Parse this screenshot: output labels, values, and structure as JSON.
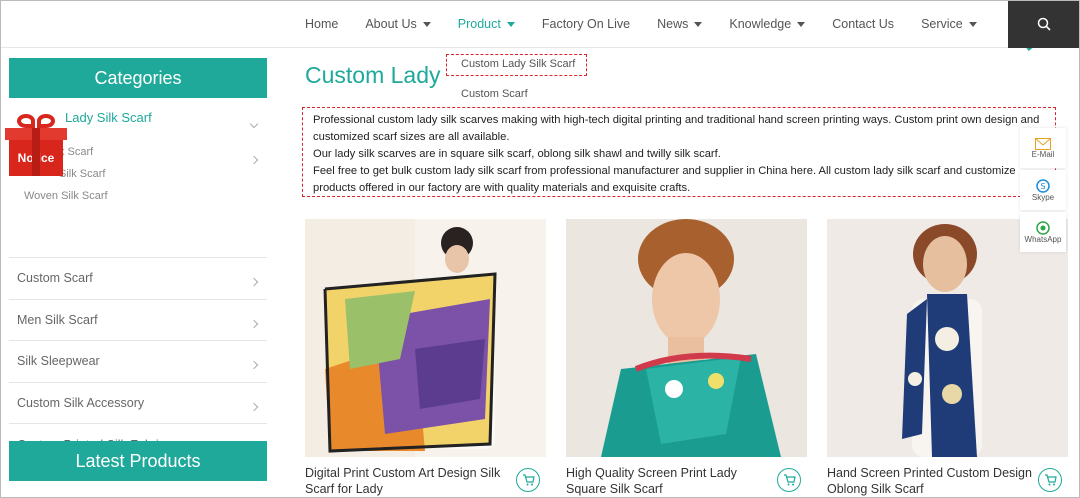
{
  "nav": {
    "items": [
      {
        "label": "Home",
        "dropdown": false
      },
      {
        "label": "About Us",
        "dropdown": true
      },
      {
        "label": "Product",
        "dropdown": true,
        "active": true
      },
      {
        "label": "Factory On Live",
        "dropdown": false
      },
      {
        "label": "News",
        "dropdown": true
      },
      {
        "label": "Knowledge",
        "dropdown": true
      },
      {
        "label": "Contact Us",
        "dropdown": false
      },
      {
        "label": "Service",
        "dropdown": true
      }
    ]
  },
  "dropdown": {
    "items": [
      "Custom Lady Silk Scarf",
      "Custom Scarf"
    ]
  },
  "sidebar": {
    "header": "Categories",
    "active_category": "Lady Silk Scarf",
    "sub_items": [
      "k Scarf",
      "Silk Scarf",
      "Woven Silk Scarf"
    ],
    "categories": [
      "Custom Scarf",
      "Men Silk Scarf",
      "Silk Sleepwear",
      "Custom Silk Accessory",
      "Custom Printed Silk Fabric"
    ],
    "latest": "Latest Products"
  },
  "notice": {
    "label": "Notice"
  },
  "main": {
    "title": "Custom Lady",
    "description": [
      "Professional custom lady silk scarves making with high-tech digital printing and traditional hand screen printing ways. Custom print own design and",
      "customized scarf sizes are all available.",
      "Our lady silk scarves are in square silk scarf, oblong silk shawl and twilly silk scarf.",
      "Feel free to get bulk custom lady silk scarf from professional manufacturer and supplier in China here. All custom lady silk scarf and customize",
      "products offered in our factory are with quality materials and exquisite crafts."
    ]
  },
  "products": [
    {
      "name": "Digital Print Custom Art Design Silk Scarf for Lady"
    },
    {
      "name": "High Quality Screen Print Lady Square Silk Scarf"
    },
    {
      "name": "Hand Screen Printed Custom Design Oblong Silk Scarf"
    }
  ],
  "contact": {
    "email": "E-Mail",
    "skype": "Skype",
    "whatsapp": "WhatsApp"
  },
  "colors": {
    "accent": "#1fa99a",
    "highlight": "#d9262c",
    "dark": "#333333"
  }
}
